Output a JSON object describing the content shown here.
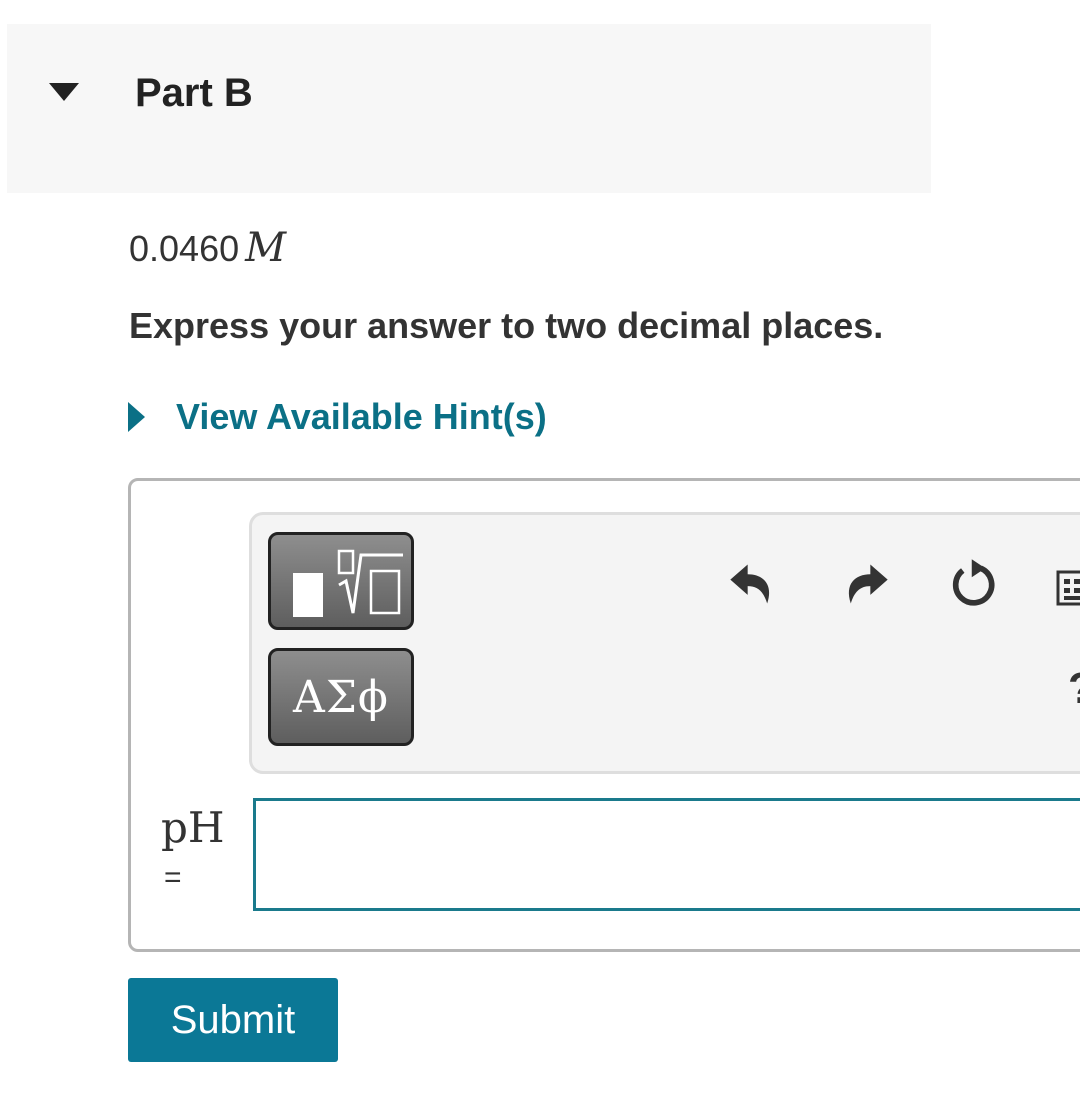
{
  "part": {
    "title": "Part B",
    "expanded_icon": "caret-down-icon"
  },
  "question": {
    "value": "0.0460",
    "unit": "M",
    "instruction": "Express your answer to two decimal places."
  },
  "hint": {
    "label": "View Available Hint(s)",
    "icon": "caret-right-icon"
  },
  "toolbar": {
    "templates_icon": "templates-icon",
    "symbols_label": "ΑΣϕ",
    "undo_icon": "undo-icon",
    "redo_icon": "redo-icon",
    "reset_icon": "reset-icon",
    "keyboard_icon": "keyboard-icon",
    "help_label": "?"
  },
  "answer": {
    "variable": "pH",
    "equals": "=",
    "value": ""
  },
  "submit": {
    "label": "Submit"
  },
  "colors": {
    "accent": "#0b7086",
    "submit_bg": "#0b7896",
    "input_border": "#1a7a8c",
    "header_bg": "#f7f7f7",
    "toolbar_bg": "#f4f4f4"
  }
}
